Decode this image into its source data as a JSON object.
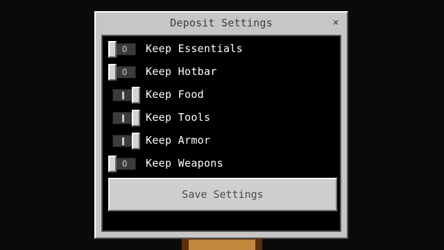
{
  "dialog": {
    "title": "Deposit Settings",
    "close_icon": "×",
    "save_label": "Save Settings"
  },
  "settings": [
    {
      "label": "Keep Essentials",
      "enabled": false,
      "glyph": "O"
    },
    {
      "label": "Keep Hotbar",
      "enabled": false,
      "glyph": "O"
    },
    {
      "label": "Keep Food",
      "enabled": true,
      "glyph": "|"
    },
    {
      "label": "Keep Tools",
      "enabled": true,
      "glyph": "|"
    },
    {
      "label": "Keep Armor",
      "enabled": true,
      "glyph": "|"
    },
    {
      "label": "Keep Weapons",
      "enabled": false,
      "glyph": "O"
    }
  ],
  "colors": {
    "dialog_bg": "#c6c6c6",
    "panel_bg": "#000000",
    "button_bg": "#cfcfcf",
    "text_light": "#ffffff",
    "text_dark": "#3c3c3c"
  },
  "icons": {
    "close": "close-icon",
    "toggle_off": "toggle-off-icon",
    "toggle_on": "toggle-on-icon"
  }
}
